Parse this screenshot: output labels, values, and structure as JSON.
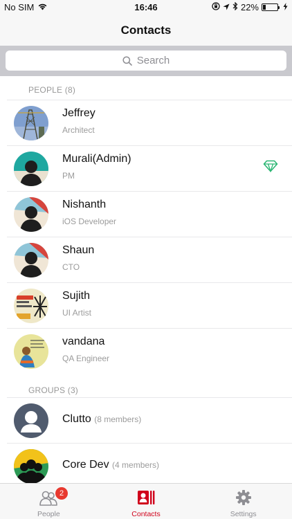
{
  "status_bar": {
    "carrier": "No SIM",
    "time": "16:46",
    "battery_percent": "22%",
    "battery_level": 0.22,
    "icons": [
      "wifi-icon",
      "orientation-lock-icon",
      "location-arrow-icon",
      "bluetooth-icon",
      "battery-icon",
      "charging-bolt-icon"
    ]
  },
  "nav": {
    "title": "Contacts"
  },
  "search": {
    "placeholder": "Search"
  },
  "people_section": {
    "label": "PEOPLE (8)",
    "contacts": [
      {
        "name": "Jeffrey",
        "role": "Architect",
        "avatar": "photo-tower"
      },
      {
        "name": "Murali(Admin)",
        "role": "PM",
        "avatar": "silhouette-teal",
        "badge_icon": "diamond-icon"
      },
      {
        "name": "Nishanth",
        "role": "iOS Developer",
        "avatar": "silhouette-beach"
      },
      {
        "name": "Shaun",
        "role": "CTO",
        "avatar": "silhouette-beach"
      },
      {
        "name": "Sujith",
        "role": "UI Artist",
        "avatar": "photo-art"
      },
      {
        "name": "vandana",
        "role": "QA Engineer",
        "avatar": "photo-illustration"
      }
    ]
  },
  "groups_section": {
    "label": "GROUPS (3)",
    "groups": [
      {
        "name": "Clutto",
        "members": "(8 members)",
        "avatar": "group-person-grey"
      },
      {
        "name": "Core Dev",
        "members": "(4 members)",
        "avatar": "group-people-yellow"
      }
    ]
  },
  "tab_bar": {
    "tabs": [
      {
        "label": "People",
        "icon": "people-icon",
        "badge": "2",
        "active": false
      },
      {
        "label": "Contacts",
        "icon": "contacts-card-icon",
        "active": true
      },
      {
        "label": "Settings",
        "icon": "gear-icon",
        "active": false
      }
    ]
  },
  "colors": {
    "accent": "#d0021b",
    "admin_diamond": "#2bb673",
    "badge": "#e8392f",
    "secondary_text": "#9b9b9b"
  }
}
